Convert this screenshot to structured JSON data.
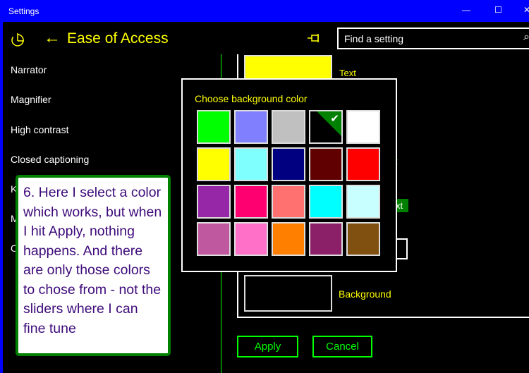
{
  "window": {
    "title": "Settings",
    "minimize": "—",
    "maximize": "☐",
    "close": "✕"
  },
  "header": {
    "title": "Ease of Access",
    "back_icon": "←",
    "home_icon": "settings-home",
    "pin_icon": "pin",
    "search_placeholder": "Find a setting",
    "search_icon": "⌕"
  },
  "sidebar": {
    "items": [
      {
        "label": "Narrator"
      },
      {
        "label": "Magnifier"
      },
      {
        "label": "High contrast"
      },
      {
        "label": "Closed captioning"
      },
      {
        "label": "K"
      },
      {
        "label": "M"
      },
      {
        "label": "O"
      }
    ]
  },
  "main": {
    "text_label": "Text",
    "background_label": "Background",
    "partial_labels": [
      "t",
      "xt",
      "t"
    ],
    "apply": "Apply",
    "cancel": "Cancel",
    "text_color": "#ffff00",
    "background_color": "#000000"
  },
  "dialog": {
    "title": "Choose background color",
    "selected_index": 3,
    "check_icon": "✔",
    "colors": [
      "#00ff00",
      "#8080ff",
      "#c0c0c0",
      "#000000",
      "#ffffff",
      "#ffff00",
      "#80ffff",
      "#000080",
      "#600000",
      "#ff0000",
      "#9628a8",
      "#ff0070",
      "#ff7070",
      "#00ffff",
      "#c8ffff",
      "#c058a0",
      "#ff70c8",
      "#ff8000",
      "#8c2068",
      "#805010"
    ]
  },
  "annotation": {
    "text": "6. Here I select a color which works, but when I hit Apply, nothing happens. And there are only those colors to chose from - not the sliders where I can fine tune"
  }
}
